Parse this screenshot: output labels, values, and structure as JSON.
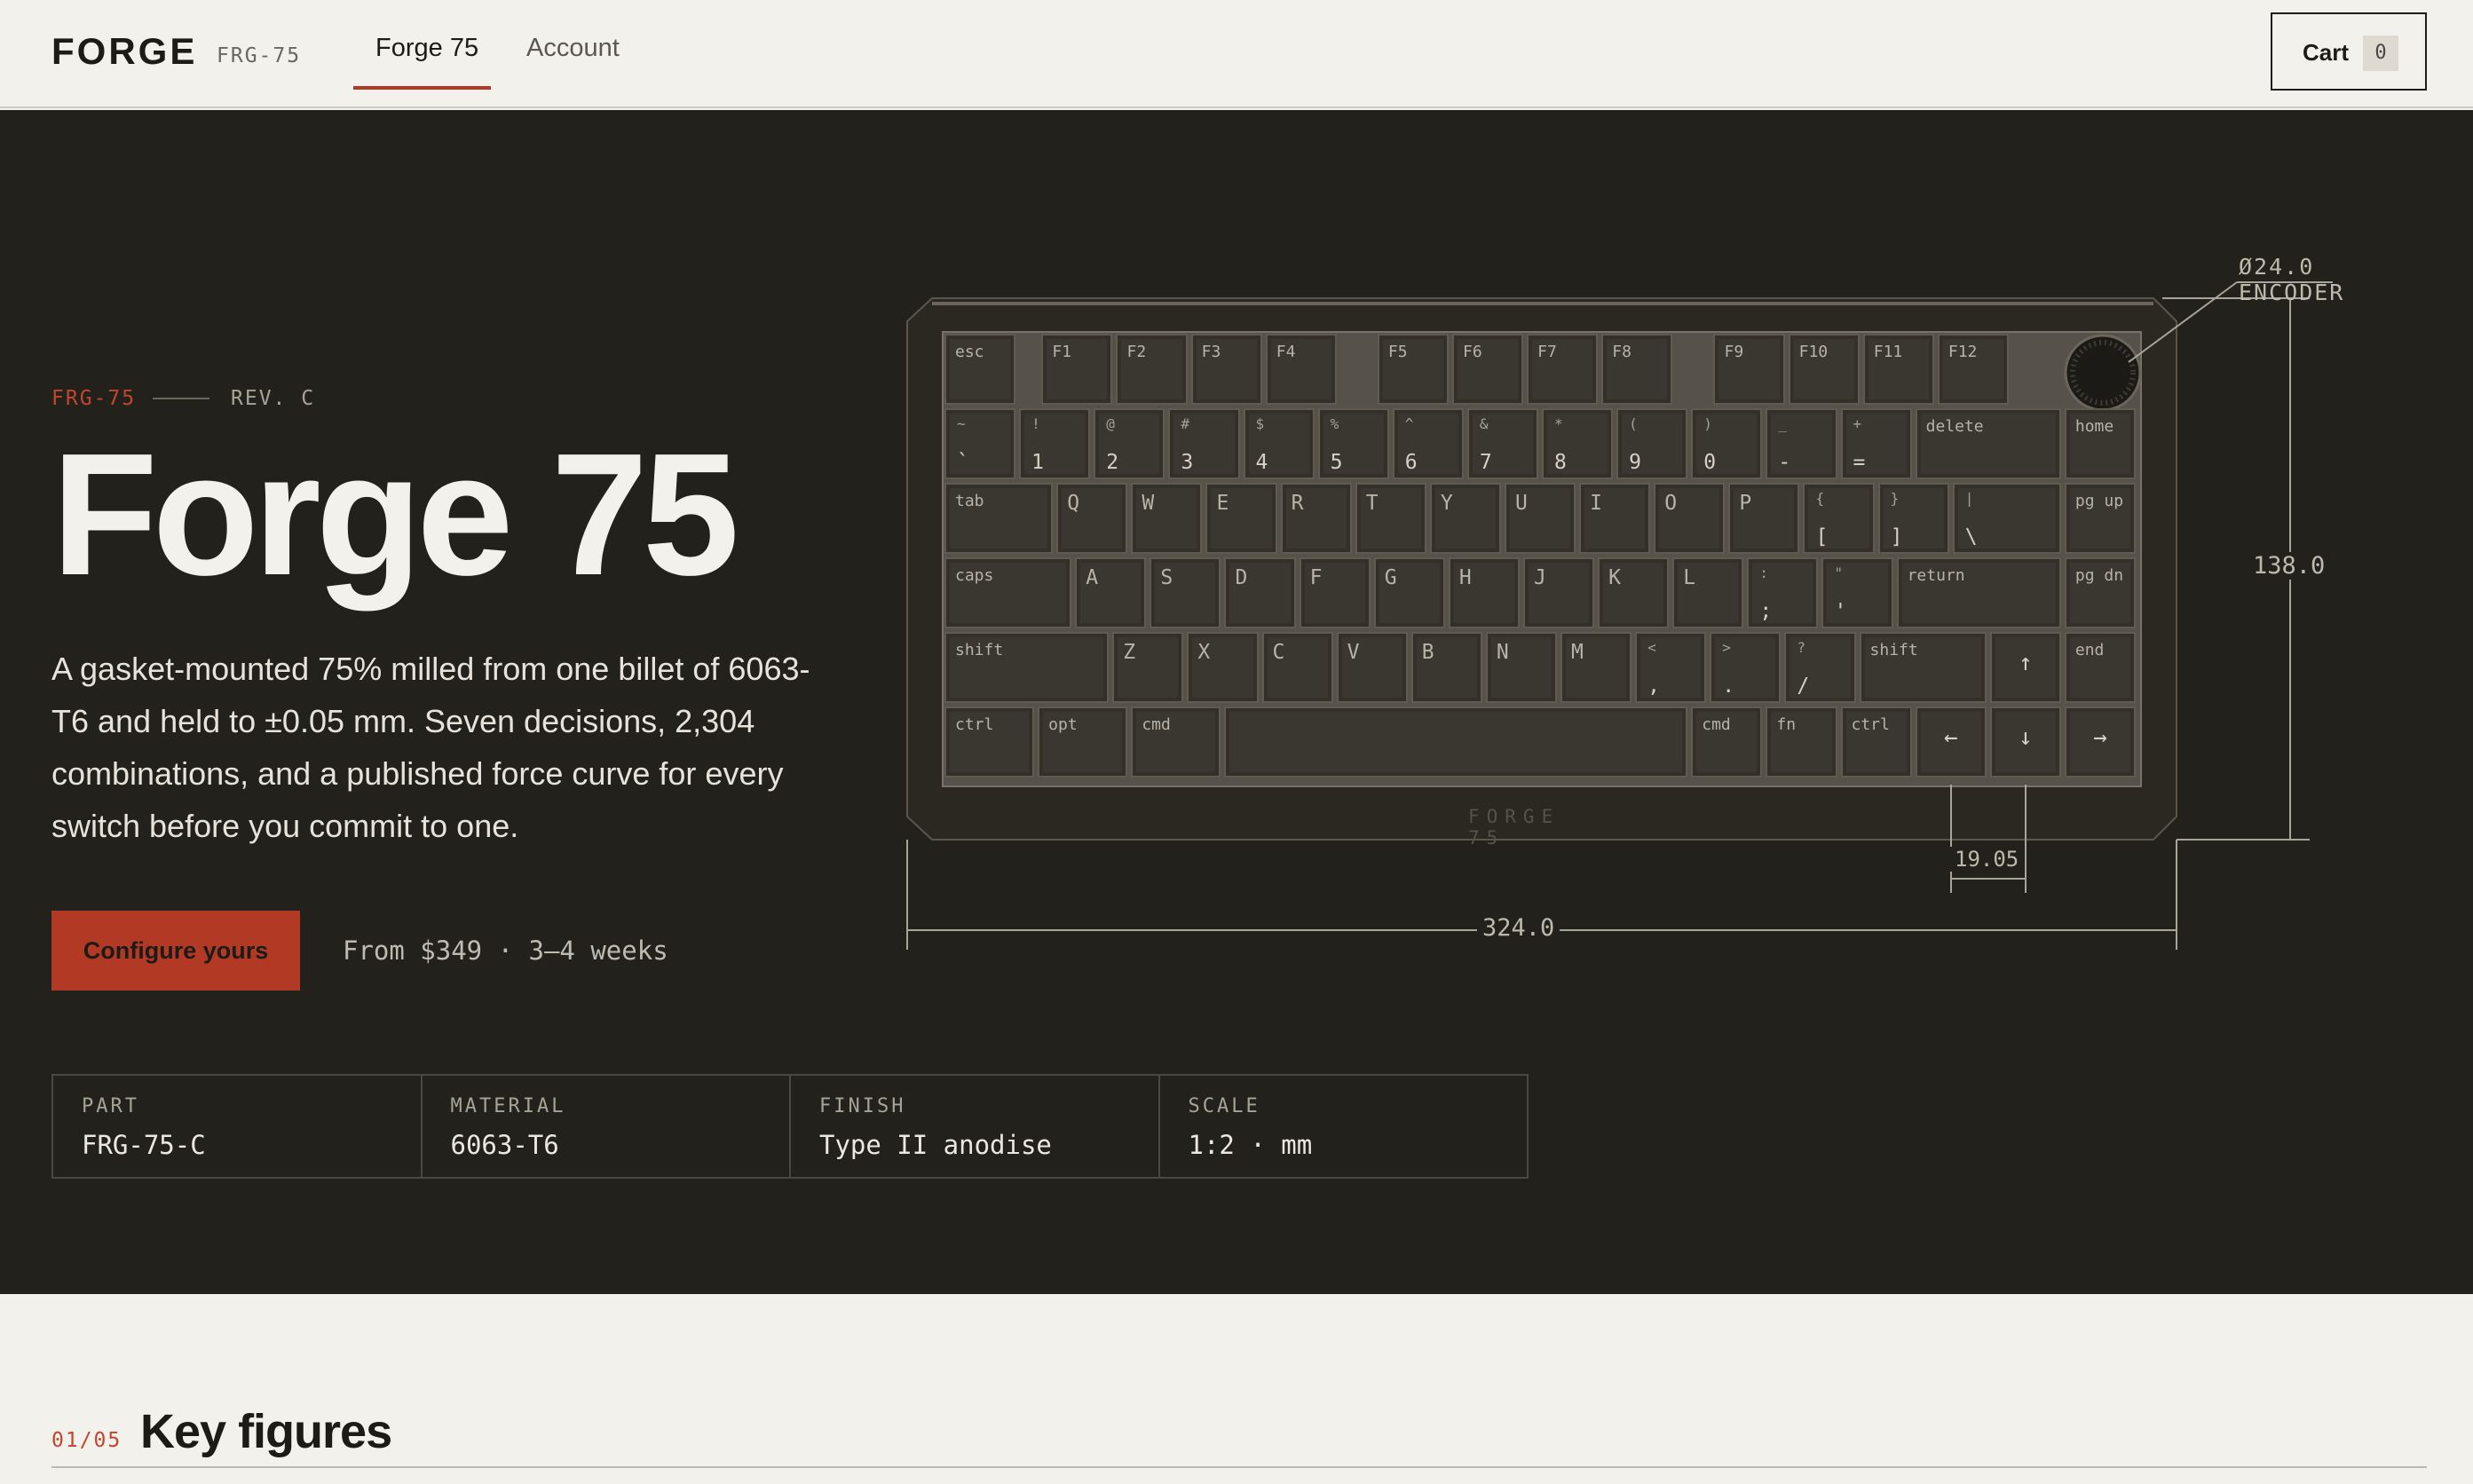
{
  "header": {
    "logo": "FORGE",
    "logo_sub": "FRG-75",
    "nav": [
      {
        "label": "Forge 75",
        "active": true
      },
      {
        "label": "Account",
        "active": false
      }
    ],
    "cart_label": "Cart",
    "cart_count": "0"
  },
  "hero": {
    "eyebrow_code": "FRG-75",
    "eyebrow_rev": "REV. C",
    "title": "Forge 75",
    "description": "A gasket-mounted 75% milled from one billet of 6063-T6 and held to ±0.05 mm. Seven decisions, 2,304 combinations, and a published force curve for every switch before you commit to one.",
    "cta_label": "Configure yours",
    "price_note": "From $349 · 3–4 weeks",
    "specs": [
      {
        "label": "PART",
        "value": "FRG-75-C"
      },
      {
        "label": "MATERIAL",
        "value": "6063-T6"
      },
      {
        "label": "FINISH",
        "value": "Type II anodise"
      },
      {
        "label": "SCALE",
        "value": "1:2 · mm"
      }
    ]
  },
  "diagram": {
    "encoder_label": "Ø24.0 ENCODER",
    "height_dim": "138.0",
    "width_dim": "324.0",
    "key_dim": "19.05",
    "case_brand": "FORGE 75",
    "rows": [
      [
        {
          "l": "esc"
        },
        {
          "l": "F1"
        },
        {
          "l": "F2"
        },
        {
          "l": "F3"
        },
        {
          "l": "F4"
        },
        {
          "l": "F5"
        },
        {
          "l": "F6"
        },
        {
          "l": "F7"
        },
        {
          "l": "F8"
        },
        {
          "l": "F9"
        },
        {
          "l": "F10"
        },
        {
          "l": "F11"
        },
        {
          "l": "F12"
        }
      ],
      [
        {
          "h": "~",
          "l": "`"
        },
        {
          "h": "!",
          "l": "1"
        },
        {
          "h": "@",
          "l": "2"
        },
        {
          "h": "#",
          "l": "3"
        },
        {
          "h": "$",
          "l": "4"
        },
        {
          "h": "%",
          "l": "5"
        },
        {
          "h": "^",
          "l": "6"
        },
        {
          "h": "&",
          "l": "7"
        },
        {
          "h": "*",
          "l": "8"
        },
        {
          "h": "(",
          "l": "9"
        },
        {
          "h": ")",
          "l": "0"
        },
        {
          "h": "_",
          "l": "-"
        },
        {
          "h": "+",
          "l": "="
        },
        {
          "l": "delete"
        },
        {
          "l": "home"
        }
      ],
      [
        {
          "l": "tab"
        },
        {
          "l": "Q"
        },
        {
          "l": "W"
        },
        {
          "l": "E"
        },
        {
          "l": "R"
        },
        {
          "l": "T"
        },
        {
          "l": "Y"
        },
        {
          "l": "U"
        },
        {
          "l": "I"
        },
        {
          "l": "O"
        },
        {
          "l": "P"
        },
        {
          "h": "{",
          "l": "["
        },
        {
          "h": "}",
          "l": "]"
        },
        {
          "h": "|",
          "l": "\\"
        },
        {
          "l": "pg up"
        }
      ],
      [
        {
          "l": "caps"
        },
        {
          "l": "A"
        },
        {
          "l": "S"
        },
        {
          "l": "D"
        },
        {
          "l": "F"
        },
        {
          "l": "G"
        },
        {
          "l": "H"
        },
        {
          "l": "J"
        },
        {
          "l": "K"
        },
        {
          "l": "L"
        },
        {
          "h": ":",
          "l": ";"
        },
        {
          "h": "\"",
          "l": "'"
        },
        {
          "l": "return"
        },
        {
          "l": "pg dn"
        }
      ],
      [
        {
          "l": "shift"
        },
        {
          "l": "Z"
        },
        {
          "l": "X"
        },
        {
          "l": "C"
        },
        {
          "l": "V"
        },
        {
          "l": "B"
        },
        {
          "l": "N"
        },
        {
          "l": "M"
        },
        {
          "h": "<",
          "l": ","
        },
        {
          "h": ">",
          "l": "."
        },
        {
          "h": "?",
          "l": "/"
        },
        {
          "l": "shift"
        },
        {
          "l": "↑"
        },
        {
          "l": "end"
        }
      ],
      [
        {
          "l": "ctrl"
        },
        {
          "l": "opt"
        },
        {
          "l": "cmd"
        },
        {
          "l": ""
        },
        {
          "l": "cmd"
        },
        {
          "l": "fn"
        },
        {
          "l": "ctrl"
        },
        {
          "l": "←"
        },
        {
          "l": "↓"
        },
        {
          "l": "→"
        }
      ]
    ]
  },
  "section": {
    "number": "01/05",
    "title": "Key figures"
  }
}
